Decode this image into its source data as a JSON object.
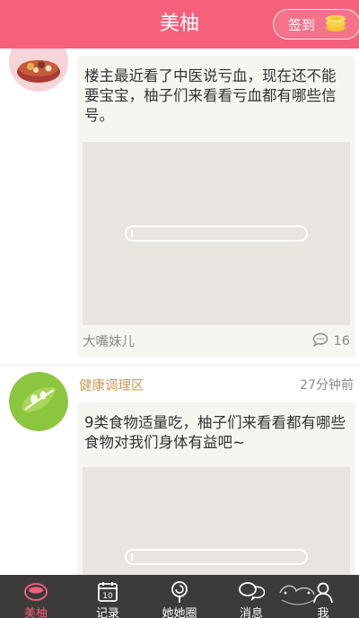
{
  "header": {
    "title": "美柚",
    "signin_label": "签到"
  },
  "posts": [
    {
      "text": "楼主最近看了中医说亏血，现在还不能要宝宝，柚子们来看看亏血都有哪些信号。",
      "author": "大嘴妹儿",
      "comment_count": "16"
    },
    {
      "category": "健康调理区",
      "time": "27分钟前",
      "text": "9类食物适量吃，柚子们来看看都有哪些食物对我们身体有益吧~"
    }
  ],
  "tabs": [
    {
      "label": "美柚",
      "icon": "meiyou-bowl-icon",
      "active": true
    },
    {
      "label": "记录",
      "icon": "calendar-icon",
      "active": false
    },
    {
      "label": "她她圈",
      "icon": "lollipop-icon",
      "active": false
    },
    {
      "label": "消息",
      "icon": "chat-bubbles-icon",
      "active": false
    },
    {
      "label": "我",
      "icon": "user-icon",
      "active": false
    }
  ],
  "colors": {
    "brand": "#f5607a",
    "tabbar": "#3d3a3a",
    "category": "#c99a52"
  }
}
